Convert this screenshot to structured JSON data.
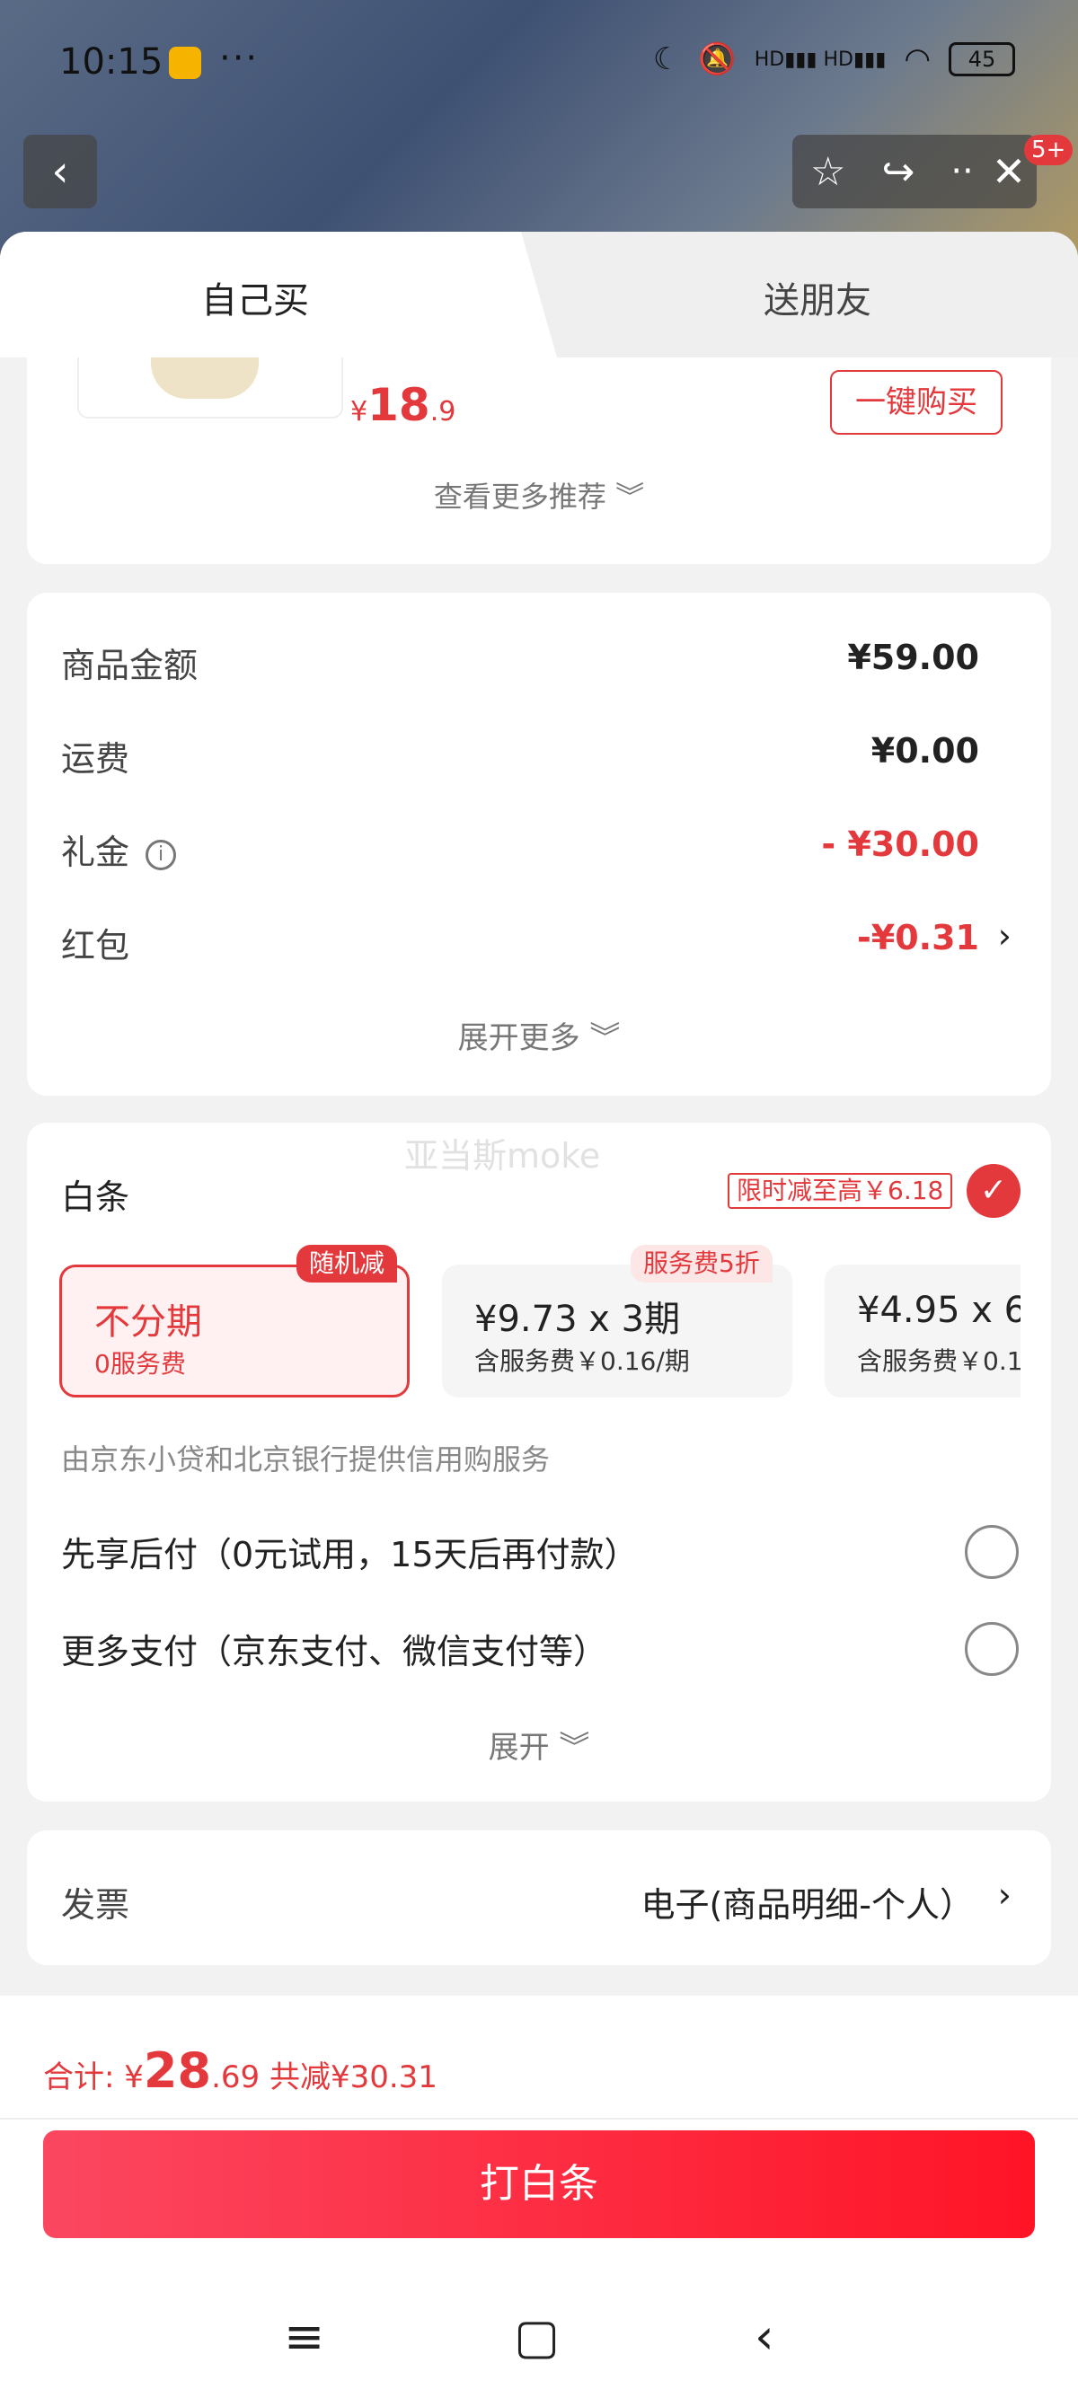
{
  "status_bar": {
    "time": "10:15",
    "dots": "···",
    "signal_icons": "HD▮▮▮ HD▮▮▮",
    "battery": "45"
  },
  "header": {
    "back_glyph": "‹",
    "badge": "5+",
    "close_glyph": "✕"
  },
  "tabs": [
    {
      "label": "自己买"
    },
    {
      "label": "送朋友"
    }
  ],
  "recommend": {
    "price_symbol": "¥",
    "price_int": "18",
    "price_dec": ".9",
    "one_click_buy": "一键购买",
    "more_recommend": "查看更多推荐 ︾"
  },
  "summary": {
    "rows": [
      {
        "label": "商品金额",
        "value": "¥59.00"
      },
      {
        "label": "运费",
        "value": "¥0.00"
      },
      {
        "label": "礼金",
        "value": "- ¥30.00"
      },
      {
        "label": "红包",
        "value": "-¥0.31"
      }
    ],
    "expand_more": "展开更多 ︾",
    "info_glyph": "i",
    "chevron": "›"
  },
  "baitiao": {
    "watermark": "亚当斯moke",
    "title": "白条",
    "promo": "限时减至高￥6.18",
    "check_glyph": "✓",
    "plans": [
      {
        "tag": "随机减",
        "main": "不分期",
        "sub": "0服务费"
      },
      {
        "tag": "服务费5折",
        "main": "¥9.73 x 3期",
        "sub": "含服务费￥0.16/期"
      },
      {
        "tag": "",
        "main": "¥4.95 x 6",
        "sub": "含服务费￥0.1"
      }
    ],
    "provider": "由京东小贷和北京银行提供信用购服务",
    "pay_options": [
      {
        "label": "先享后付（0元试用，15天后再付款）"
      },
      {
        "label": "更多支付（京东支付、微信支付等）"
      }
    ],
    "expand": "展开 ︾"
  },
  "invoice": {
    "label": "发票",
    "value": "电子(商品明细-个人）",
    "chevron": "›"
  },
  "footer": {
    "total_label": "合计: ",
    "total_symbol": "¥",
    "total_int": "28",
    "total_dec": ".69",
    "total_saved": " 共减¥30.31",
    "pay_button": "打白条"
  },
  "nav": {
    "menu_glyph": "≡",
    "home_glyph": "▢",
    "back_glyph": "‹"
  },
  "colors": {
    "accent_red": "#e4393c",
    "button_gradient_start": "#fb4760",
    "button_gradient_end": "#ff1426"
  },
  "icons": [
    "note-icon",
    "moon-icon",
    "mute-icon",
    "wifi-icon",
    "battery-icon",
    "back-icon",
    "star-icon",
    "share-icon",
    "more-icon",
    "close-icon",
    "info-icon",
    "check-icon",
    "chevron-right-icon",
    "menu-icon",
    "home-icon"
  ]
}
